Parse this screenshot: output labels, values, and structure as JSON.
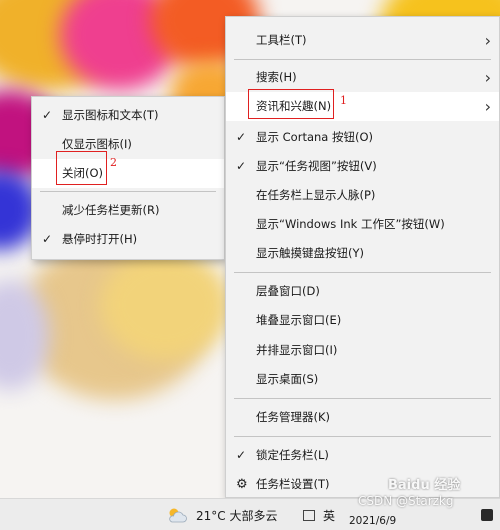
{
  "submenu": {
    "items": [
      {
        "label": "显示图标和文本(T)",
        "checked": true
      },
      {
        "label": "仅显示图标(I)",
        "checked": false
      },
      {
        "label": "关闭(O)",
        "checked": false,
        "annotation": "2"
      },
      {
        "label": "减少任务栏更新(R)",
        "checked": false
      },
      {
        "label": "悬停时打开(H)",
        "checked": true
      }
    ]
  },
  "context_menu": {
    "items": [
      {
        "label": "工具栏(T)",
        "submenu": true
      },
      {
        "label": "搜索(H)",
        "submenu": true
      },
      {
        "label": "资讯和兴趣(N)",
        "submenu": true,
        "annotation": "1"
      },
      {
        "label": "显示 Cortana 按钮(O)",
        "checked": true
      },
      {
        "label": "显示“任务视图”按钮(V)",
        "checked": true
      },
      {
        "label": "在任务栏上显示人脉(P)"
      },
      {
        "label": "显示“Windows Ink 工作区”按钮(W)"
      },
      {
        "label": "显示触摸键盘按钮(Y)"
      },
      {
        "label": "层叠窗口(D)"
      },
      {
        "label": "堆叠显示窗口(E)"
      },
      {
        "label": "并排显示窗口(I)"
      },
      {
        "label": "显示桌面(S)"
      },
      {
        "label": "任务管理器(K)"
      },
      {
        "label": "锁定任务栏(L)",
        "checked": true
      },
      {
        "label": "任务栏设置(T)",
        "icon": "gear-icon"
      }
    ]
  },
  "taskbar": {
    "weather_icon": "cloud-sun-icon",
    "weather": "21°C 大部多云",
    "ime": "英",
    "date": "2021/6/9"
  },
  "watermark": {
    "csdn": "CSDN @Starzkg",
    "baidu": "Baidu 经验"
  },
  "colors": {
    "menu_bg": "#f2f2f2",
    "menu_highlight": "#ffffff",
    "annotation_red": "#e02020"
  }
}
